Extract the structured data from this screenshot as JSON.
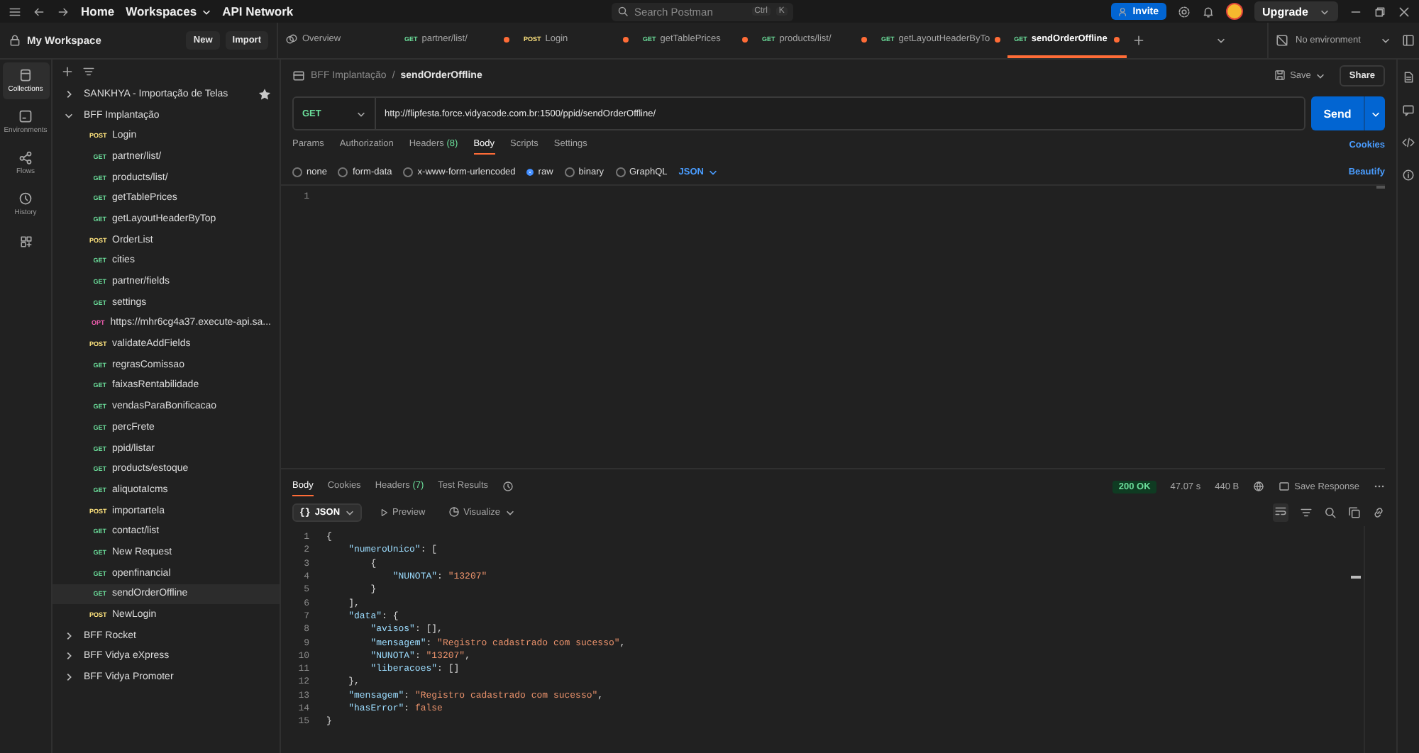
{
  "top_bar": {
    "nav": [
      "Home",
      "Workspaces",
      "API Network"
    ],
    "search": {
      "placeholder": "Search Postman",
      "keys": [
        "Ctrl",
        "K"
      ]
    },
    "invite": "Invite",
    "upgrade": "Upgrade"
  },
  "workspace": {
    "title": "My Workspace",
    "buttons": [
      "New",
      "Import"
    ]
  },
  "left_nav": [
    {
      "label": "Collections",
      "selected": true
    },
    {
      "label": "Environments",
      "selected": false
    },
    {
      "label": "Flows",
      "selected": false
    },
    {
      "label": "History",
      "selected": false
    }
  ],
  "tabs": [
    {
      "kind": "overview",
      "label": "Overview",
      "selected": false
    },
    {
      "kind": "request",
      "method": "GET",
      "label": "partner/list/",
      "modified": true,
      "selected": false
    },
    {
      "kind": "request",
      "method": "POST",
      "label": "Login",
      "modified": true,
      "selected": false
    },
    {
      "kind": "request",
      "method": "GET",
      "label": "getTablePrices",
      "modified": true,
      "selected": false
    },
    {
      "kind": "request",
      "method": "GET",
      "label": "products/list/",
      "modified": true,
      "selected": false
    },
    {
      "kind": "request",
      "method": "GET",
      "label": "getLayoutHeaderByTo",
      "modified": true,
      "selected": false
    },
    {
      "kind": "request",
      "method": "GET",
      "label": "sendOrderOffline",
      "modified": true,
      "selected": true
    }
  ],
  "environment": "No environment",
  "collections": [
    {
      "name": "SANKHYA - Importação de Telas",
      "expanded": false,
      "starred": true
    },
    {
      "name": "BFF Implantação",
      "expanded": true,
      "starred": false,
      "children": [
        {
          "method": "POST",
          "name": "Login",
          "selected": false
        },
        {
          "method": "GET",
          "name": "partner/list/",
          "selected": false
        },
        {
          "method": "GET",
          "name": "products/list/",
          "selected": false
        },
        {
          "method": "GET",
          "name": "getTablePrices",
          "selected": false
        },
        {
          "method": "GET",
          "name": "getLayoutHeaderByTop",
          "selected": false
        },
        {
          "method": "POST",
          "name": "OrderList",
          "selected": false
        },
        {
          "method": "GET",
          "name": "cities",
          "selected": false
        },
        {
          "method": "GET",
          "name": "partner/fields",
          "selected": false
        },
        {
          "method": "GET",
          "name": "settings",
          "selected": false
        },
        {
          "method": "OPT",
          "name": "https://mhr6cg4a37.execute-api.sa...",
          "selected": false
        },
        {
          "method": "POST",
          "name": "validateAddFields",
          "selected": false
        },
        {
          "method": "GET",
          "name": "regrasComissao",
          "selected": false
        },
        {
          "method": "GET",
          "name": "faixasRentabilidade",
          "selected": false
        },
        {
          "method": "GET",
          "name": "vendasParaBonificacao",
          "selected": false
        },
        {
          "method": "GET",
          "name": "percFrete",
          "selected": false
        },
        {
          "method": "GET",
          "name": "ppid/listar",
          "selected": false
        },
        {
          "method": "GET",
          "name": "products/estoque",
          "selected": false
        },
        {
          "method": "GET",
          "name": "aliquotaIcms",
          "selected": false
        },
        {
          "method": "POST",
          "name": "importartela",
          "selected": false
        },
        {
          "method": "GET",
          "name": "contact/list",
          "selected": false
        },
        {
          "method": "GET",
          "name": "New Request",
          "selected": false
        },
        {
          "method": "GET",
          "name": "openfinancial",
          "selected": false
        },
        {
          "method": "GET",
          "name": "sendOrderOffline",
          "selected": true
        },
        {
          "method": "POST",
          "name": "NewLogin",
          "selected": false
        }
      ]
    },
    {
      "name": "BFF Rocket",
      "expanded": false,
      "starred": false
    },
    {
      "name": "BFF Vidya eXpress",
      "expanded": false,
      "starred": false
    },
    {
      "name": "BFF Vidya Promoter",
      "expanded": false,
      "starred": false
    }
  ],
  "request": {
    "breadcrumb": [
      "BFF Implantação",
      "sendOrderOffline"
    ],
    "breadcrumb_separator": "/",
    "save": "Save",
    "share": "Share",
    "method": "GET",
    "url": "http://flipfesta.force.vidyacode.com.br:1500/ppid/sendOrderOffline/",
    "send": "Send",
    "tabs": [
      {
        "label": "Params",
        "selected": false
      },
      {
        "label": "Authorization",
        "selected": false
      },
      {
        "label": "Headers",
        "count": "(8)",
        "selected": false
      },
      {
        "label": "Body",
        "selected": true
      },
      {
        "label": "Scripts",
        "selected": false
      },
      {
        "label": "Settings",
        "selected": false
      }
    ],
    "cookies": "Cookies",
    "body_types": [
      {
        "label": "none",
        "selected": false
      },
      {
        "label": "form-data",
        "selected": false
      },
      {
        "label": "x-www-form-urlencoded",
        "selected": false
      },
      {
        "label": "raw",
        "selected": true
      },
      {
        "label": "binary",
        "selected": false
      },
      {
        "label": "GraphQL",
        "selected": false
      }
    ],
    "format": "JSON",
    "beautify": "Beautify",
    "editor_lines": [
      "1"
    ]
  },
  "response": {
    "tabs": [
      {
        "label": "Body",
        "selected": true
      },
      {
        "label": "Cookies",
        "selected": false
      },
      {
        "label": "Headers",
        "count": "(7)",
        "selected": false
      },
      {
        "label": "Test Results",
        "selected": false
      }
    ],
    "status": "200 OK",
    "time": "47.07 s",
    "size": "440 B",
    "save": "Save Response",
    "views": [
      {
        "kind": "select",
        "icon": "{}",
        "label": "JSON",
        "selected": true
      },
      {
        "kind": "preview",
        "label": "Preview",
        "selected": false
      },
      {
        "kind": "visualize",
        "label": "Visualize",
        "selected": false
      }
    ],
    "lines": [
      {
        "num": "1",
        "code": "{"
      },
      {
        "num": "2",
        "code": "    \"numeroUnico\": ["
      },
      {
        "num": "3",
        "code": "        {"
      },
      {
        "num": "4",
        "code": "            \"NUNOTA\": \"13207\""
      },
      {
        "num": "5",
        "code": "        }"
      },
      {
        "num": "6",
        "code": "    ],"
      },
      {
        "num": "7",
        "code": "    \"data\": {"
      },
      {
        "num": "8",
        "code": "        \"avisos\": [],"
      },
      {
        "num": "9",
        "code": "        \"mensagem\": \"Registro cadastrado com sucesso\","
      },
      {
        "num": "10",
        "code": "        \"NUNOTA\": \"13207\","
      },
      {
        "num": "11",
        "code": "        \"liberacoes\": []"
      },
      {
        "num": "12",
        "code": "    },"
      },
      {
        "num": "13",
        "code": "    \"mensagem\": \"Registro cadastrado com sucesso\","
      },
      {
        "num": "14",
        "code": "    \"hasError\": false"
      },
      {
        "num": "15",
        "code": "}"
      }
    ]
  }
}
